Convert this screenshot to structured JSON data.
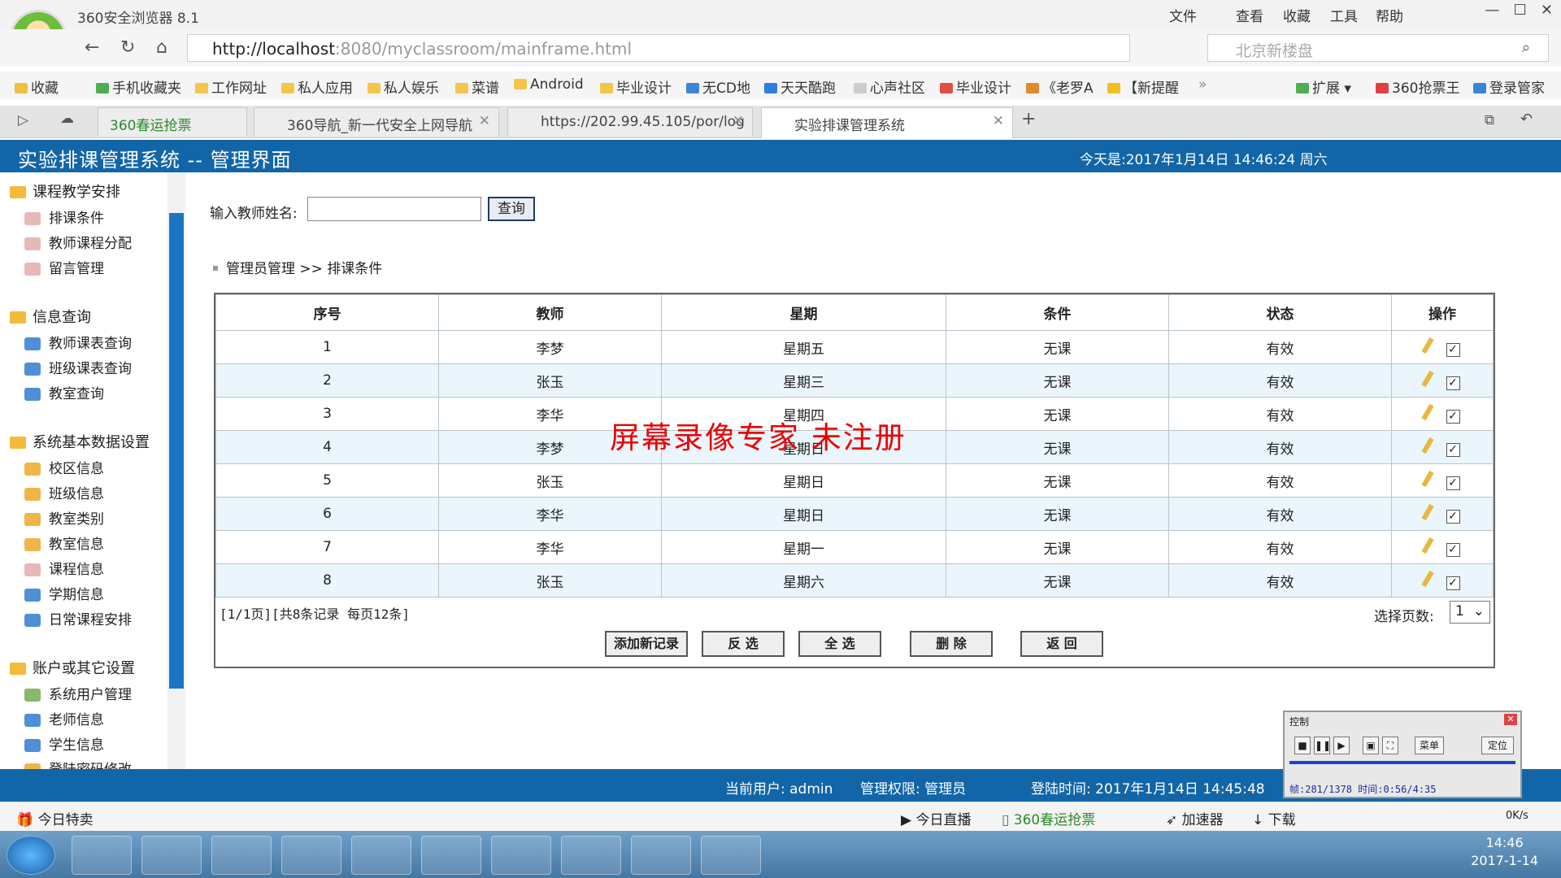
{
  "browser": {
    "title": "360安全浏览器 8.1",
    "menus": [
      "文件",
      "查看",
      "收藏",
      "工具",
      "帮助"
    ],
    "url_host": "http://localhost",
    "url_rest": ":8080/myclassroom/mainframe.html",
    "search_placeholder": "北京新楼盘",
    "bookmarks": [
      "收藏",
      "手机收藏夹",
      "工作网址",
      "私人应用",
      "私人娱乐",
      "菜谱",
      "Android",
      "毕业设计",
      "无CD地",
      "天天酷跑",
      "心声社区",
      "毕业设计",
      "《老罗A",
      "【新提醒"
    ],
    "tabs": [
      {
        "label": "360春运抢票",
        "active": false
      },
      {
        "label": "360导航_新一代安全上网导航",
        "active": false
      },
      {
        "label": "https://202.99.45.105/por/log",
        "active": false
      },
      {
        "label": "实验排课管理系统",
        "active": true
      }
    ],
    "ext_label": "扩展",
    "ticket_label": "360抢票王",
    "login_label": "登录管家"
  },
  "app": {
    "title": "实验排课管理系统 -- 管理界面",
    "today": "今天是:2017年1月14日  14:46:24   周六"
  },
  "sidebar": {
    "groups": [
      {
        "label": "课程教学安排",
        "items": [
          "排课条件",
          "教师课程分配",
          "留言管理"
        ]
      },
      {
        "label": "信息查询",
        "items": [
          "教师课表查询",
          "班级课表查询",
          "教室查询"
        ]
      },
      {
        "label": "系统基本数据设置",
        "items": [
          "校区信息",
          "班级信息",
          "教室类别",
          "教室信息",
          "课程信息",
          "学期信息",
          "日常课程安排"
        ]
      },
      {
        "label": "账户或其它设置",
        "items": [
          "系统用户管理",
          "老师信息",
          "学生信息",
          "登陆密码修改"
        ]
      }
    ]
  },
  "search": {
    "label": "输入教师姓名:",
    "value": "",
    "button": "查询"
  },
  "breadcrumb": {
    "root": "管理员管理",
    "sep": ">>",
    "current": "排课条件"
  },
  "table": {
    "headers": [
      "序号",
      "教师",
      "星期",
      "条件",
      "状态",
      "操作"
    ],
    "rows": [
      [
        "1",
        "李梦",
        "星期五",
        "无课",
        "有效"
      ],
      [
        "2",
        "张玉",
        "星期三",
        "无课",
        "有效"
      ],
      [
        "3",
        "李华",
        "星期四",
        "无课",
        "有效"
      ],
      [
        "4",
        "李梦",
        "星期日",
        "无课",
        "有效"
      ],
      [
        "5",
        "张玉",
        "星期日",
        "无课",
        "有效"
      ],
      [
        "6",
        "李华",
        "星期日",
        "无课",
        "有效"
      ],
      [
        "7",
        "李华",
        "星期一",
        "无课",
        "有效"
      ],
      [
        "8",
        "张玉",
        "星期六",
        "无课",
        "有效"
      ]
    ]
  },
  "pager": {
    "summary": "[1/1页][共8条记录 每页12条]",
    "select_label": "选择页数:",
    "select_value": "1"
  },
  "actions": [
    "添加新记录",
    "反 选",
    "全 选",
    "删 除",
    "返 回"
  ],
  "watermark": "屏幕录像专家 未注册",
  "status": {
    "user": "当前用户: admin",
    "role": "管理权限: 管理员",
    "login_time": "登陆时间: 2017年1月14日 14:45:48"
  },
  "bottom_bar": {
    "left": "今日特卖",
    "items": [
      "今日直播",
      "360春运抢票",
      "加速器",
      "下载"
    ],
    "speed": "0K/s"
  },
  "recorder": {
    "title": "控制",
    "menu": "菜单",
    "locate": "定位",
    "info": "帧:281/1378 时间:0:56/4:35"
  },
  "clock": {
    "time": "14:46",
    "date": "2017-1-14"
  },
  "colors": {
    "header_blue": "#1266a8",
    "row_alt": "#eaf5fc",
    "watermark": "#e00000"
  }
}
